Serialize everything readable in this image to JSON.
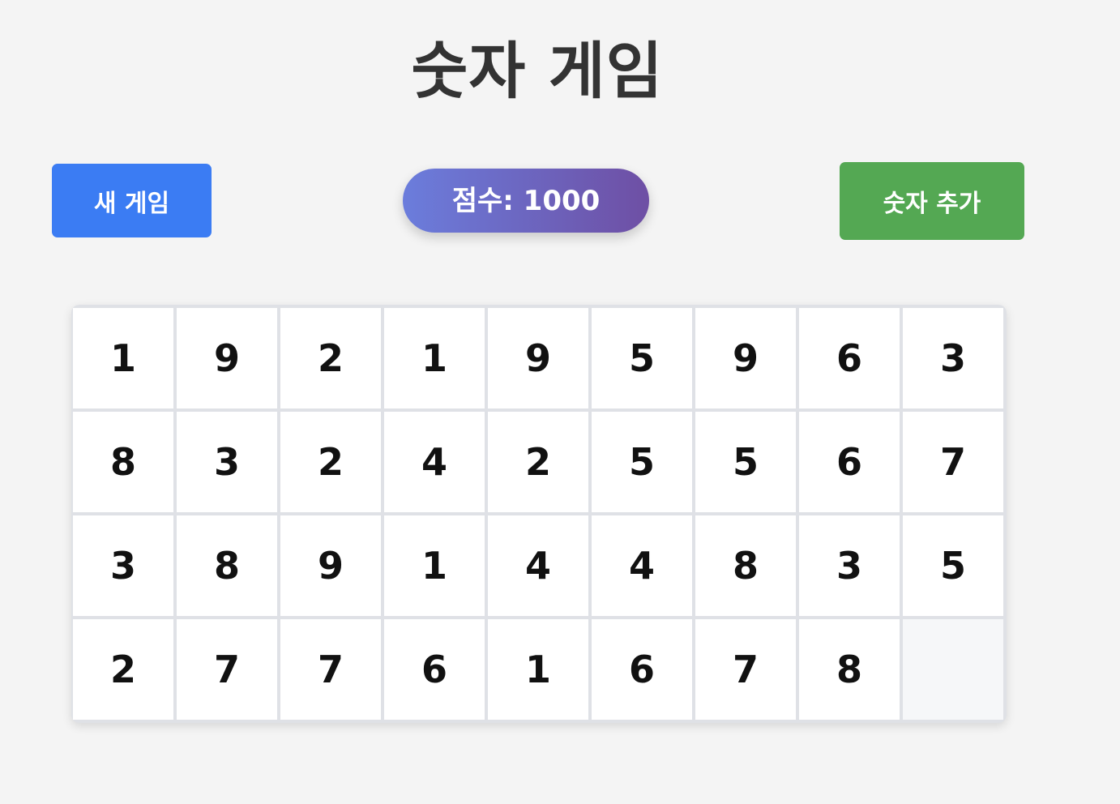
{
  "title": "숫자 게임",
  "controls": {
    "new_game_label": "새 게임",
    "score_text": "점수: 1000",
    "add_numbers_label": "숫자 추가"
  },
  "board": {
    "columns": 9,
    "cells": [
      "1",
      "9",
      "2",
      "1",
      "9",
      "5",
      "9",
      "6",
      "3",
      "8",
      "3",
      "2",
      "4",
      "2",
      "5",
      "5",
      "6",
      "7",
      "3",
      "8",
      "9",
      "1",
      "4",
      "4",
      "8",
      "3",
      "5",
      "2",
      "7",
      "7",
      "6",
      "1",
      "6",
      "7",
      "8",
      ""
    ]
  },
  "colors": {
    "new_game_button": "#3b7cf3",
    "add_numbers_button": "#54a853",
    "score_gradient_start": "#6b7ddc",
    "score_gradient_end": "#6e4fa4",
    "background": "#f4f4f4",
    "title": "#333333"
  }
}
